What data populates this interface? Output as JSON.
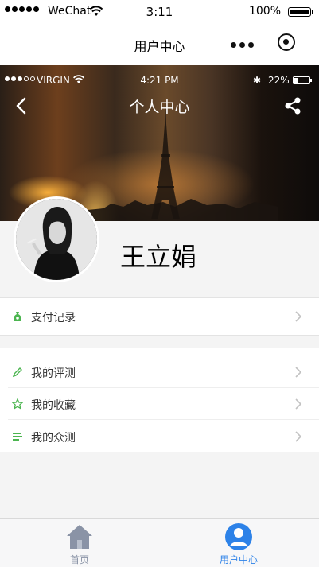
{
  "status_bar": {
    "carrier": "WeChat",
    "time": "3:11",
    "battery": "100%"
  },
  "nav": {
    "title": "用户中心"
  },
  "hero": {
    "inner_status": {
      "carrier": "VIRGIN",
      "time": "4:21 PM",
      "battery": "22%"
    },
    "page_title": "个人中心"
  },
  "profile": {
    "name": "王立娟"
  },
  "menu": {
    "group1": [
      {
        "label": "支付记录",
        "icon": "money-bag-icon"
      }
    ],
    "group2": [
      {
        "label": "我的评测",
        "icon": "pencil-icon"
      },
      {
        "label": "我的收藏",
        "icon": "star-icon"
      },
      {
        "label": "我的众测",
        "icon": "list-icon"
      }
    ]
  },
  "tabbar": {
    "tabs": [
      {
        "label": "首页",
        "icon": "home-icon",
        "active": false
      },
      {
        "label": "用户中心",
        "icon": "user-icon",
        "active": true
      }
    ]
  },
  "colors": {
    "accent_blue": "#2d82e8",
    "icon_green": "#4cb550",
    "inactive_tab": "#8a93a6"
  }
}
